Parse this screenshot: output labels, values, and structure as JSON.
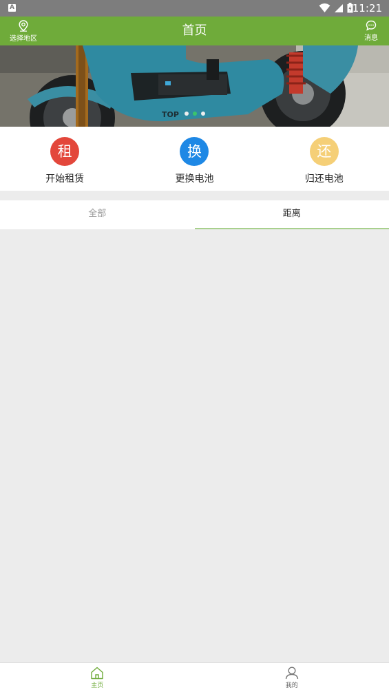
{
  "status": {
    "badge": "A",
    "time": "11:21"
  },
  "header": {
    "title": "首页",
    "left_label": "选择地区",
    "right_label": "消息"
  },
  "banner": {
    "slides": 3,
    "active_index": 1
  },
  "actions": [
    {
      "icon_char": "租",
      "label": "开始租赁",
      "color": "#e3473b"
    },
    {
      "icon_char": "换",
      "label": "更换电池",
      "color": "#1e88e5"
    },
    {
      "icon_char": "还",
      "label": "归还电池",
      "color": "#f5cf77"
    }
  ],
  "tabs": [
    {
      "label": "全部",
      "active": false
    },
    {
      "label": "距离",
      "active": true
    }
  ],
  "bottom_nav": [
    {
      "label": "主页",
      "icon": "home-icon",
      "active": true
    },
    {
      "label": "我的",
      "icon": "profile-icon",
      "active": false
    }
  ],
  "colors": {
    "primary": "#6fab3a",
    "status_bar": "#7d7d7d",
    "background": "#ececec"
  }
}
